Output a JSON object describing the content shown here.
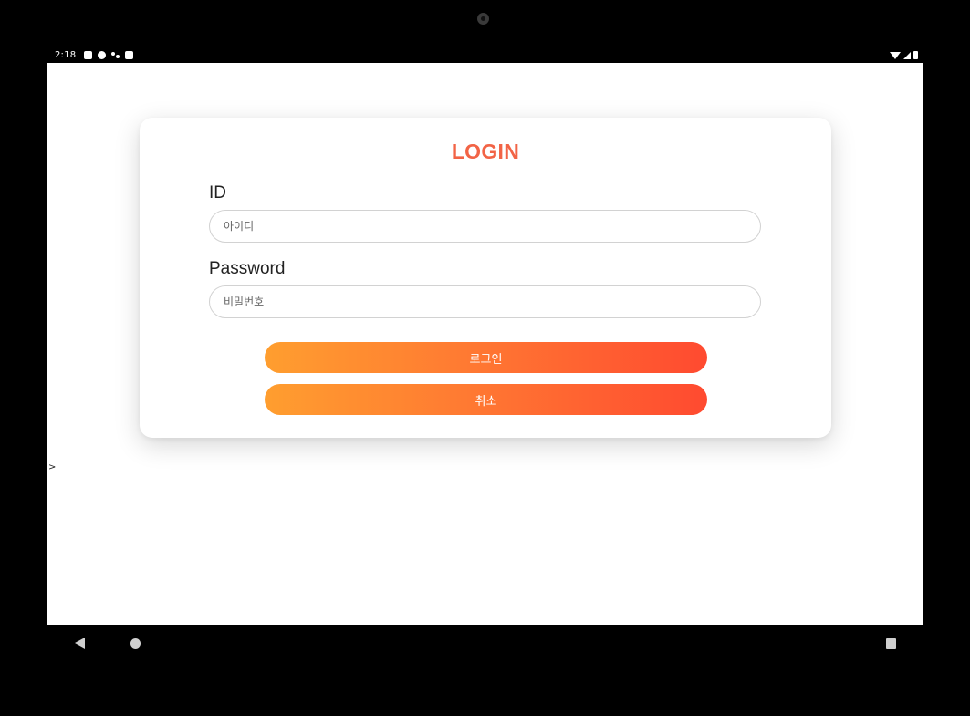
{
  "status_bar": {
    "time": "2:18",
    "left_icons": [
      "notification-a-icon",
      "notification-circle-icon",
      "notification-dots-icon",
      "sd-card-icon"
    ],
    "right_icons": [
      "wifi-icon",
      "cellular-signal-icon",
      "battery-icon"
    ]
  },
  "screen": {
    "stray_text": ">"
  },
  "login_card": {
    "title": "LOGIN",
    "id_label": "ID",
    "id_placeholder": "아이디",
    "id_value": "",
    "password_label": "Password",
    "password_placeholder": "비밀번호",
    "password_value": "",
    "login_button": "로그인",
    "cancel_button": "취소"
  },
  "colors": {
    "title": "#f26446",
    "button_gradient_start": "#ff9e2f",
    "button_gradient_end": "#ff4a30",
    "input_border": "#d2d2d2"
  },
  "nav_bar": {
    "icons": [
      "back-icon",
      "home-icon",
      "recents-icon"
    ]
  }
}
